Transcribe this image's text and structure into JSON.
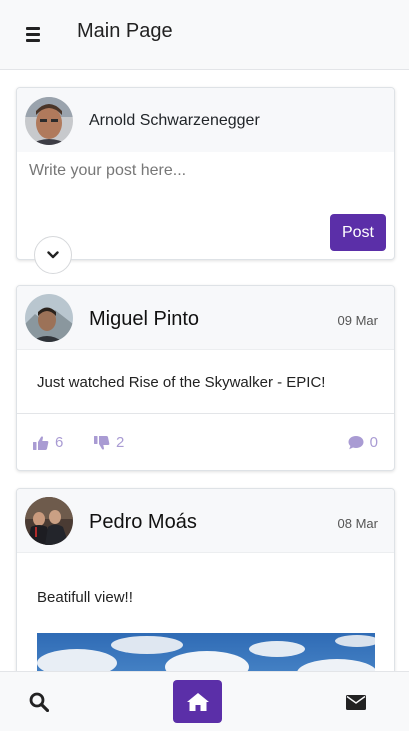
{
  "header": {
    "title": "Main Page",
    "menu_icon": "hamburger-icon"
  },
  "composer": {
    "author": "Arnold Schwarzenegger",
    "placeholder": "Write your post here...",
    "post_label": "Post",
    "expand_icon": "chevron-down-icon"
  },
  "posts": [
    {
      "author": "Miguel Pinto",
      "date": "09 Mar",
      "text": "Just watched Rise of the Skywalker - EPIC!",
      "likes": "6",
      "dislikes": "2",
      "comments": "0"
    },
    {
      "author": "Pedro Moás",
      "date": "08 Mar",
      "text": "Beatifull view!!"
    }
  ],
  "bottom_nav": {
    "items": [
      "search-icon",
      "home-icon",
      "envelope-icon"
    ]
  },
  "colors": {
    "accent": "#5b2fa8",
    "action": "#a99bd3",
    "bar_bg": "#f8f9fa"
  }
}
